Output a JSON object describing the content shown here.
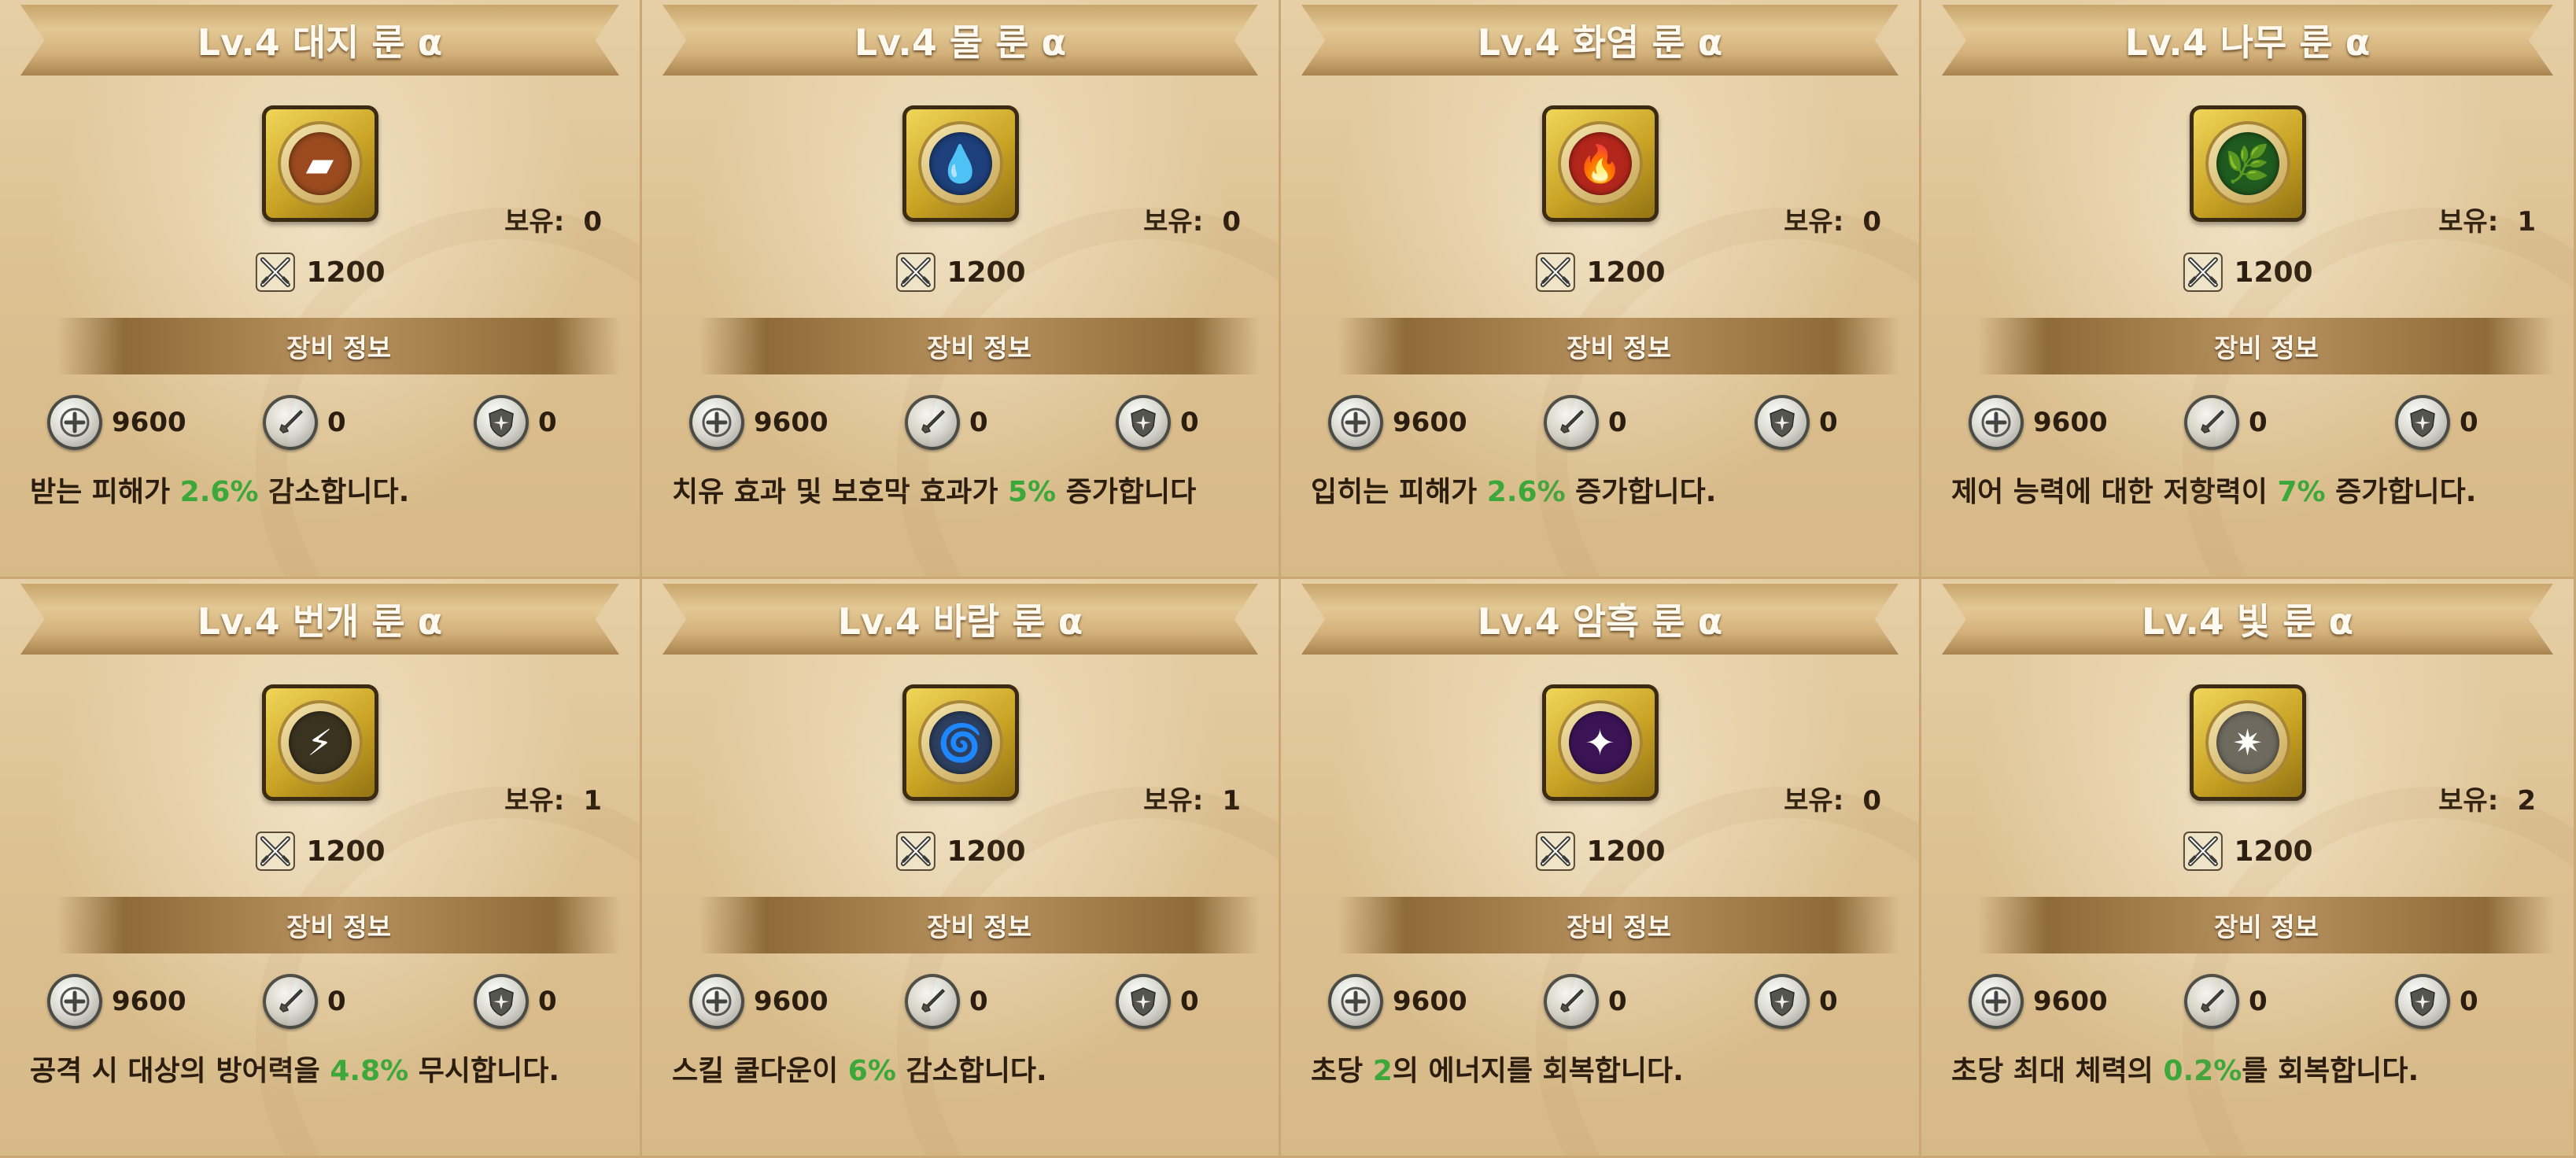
{
  "colors": {
    "highlight": "#3da83a",
    "card_bg": "#dcc196",
    "icon_frame": "#d8b530"
  },
  "cards": [
    {
      "title": "Lv.4 대지 룬 α",
      "rune_icon": "earth-rune-icon",
      "rune_color": "#9a4a1e",
      "rune_glyph": "▰",
      "owned_label": "보유:",
      "owned_value": "0",
      "cost": "1200",
      "section_label": "장비 정보",
      "hp": "9600",
      "atk": "0",
      "def": "0",
      "desc_pre": "받는 피해가 ",
      "desc_value": "2.6%",
      "desc_post": " 감소합니다."
    },
    {
      "title": "Lv.4 물 룬 α",
      "rune_icon": "water-rune-icon",
      "rune_color": "#1d3f7a",
      "rune_glyph": "💧",
      "owned_label": "보유:",
      "owned_value": "0",
      "cost": "1200",
      "section_label": "장비 정보",
      "hp": "9600",
      "atk": "0",
      "def": "0",
      "desc_pre": "치유 효과 및 보호막 효과가 ",
      "desc_value": "5%",
      "desc_post": " 증가합니다"
    },
    {
      "title": "Lv.4 화염 룬 α",
      "rune_icon": "fire-rune-icon",
      "rune_color": "#b3261b",
      "rune_glyph": "🔥",
      "owned_label": "보유:",
      "owned_value": "0",
      "cost": "1200",
      "section_label": "장비 정보",
      "hp": "9600",
      "atk": "0",
      "def": "0",
      "desc_pre": "입히는 피해가 ",
      "desc_value": "2.6%",
      "desc_post": " 증가합니다."
    },
    {
      "title": "Lv.4 나무 룬 α",
      "rune_icon": "wood-rune-icon",
      "rune_color": "#1f5a1f",
      "rune_glyph": "🌿",
      "owned_label": "보유:",
      "owned_value": "1",
      "cost": "1200",
      "section_label": "장비 정보",
      "hp": "9600",
      "atk": "0",
      "def": "0",
      "desc_pre": "제어 능력에 대한 저항력이 ",
      "desc_value": "7%",
      "desc_post": " 증가합니다."
    },
    {
      "title": "Lv.4 번개 룬 α",
      "rune_icon": "lightning-rune-icon",
      "rune_color": "#3a3320",
      "rune_glyph": "⚡",
      "owned_label": "보유:",
      "owned_value": "1",
      "cost": "1200",
      "section_label": "장비 정보",
      "hp": "9600",
      "atk": "0",
      "def": "0",
      "desc_pre": "공격 시 대상의 방어력을 ",
      "desc_value": "4.8%",
      "desc_post": " 무시합니다."
    },
    {
      "title": "Lv.4 바람 룬 α",
      "rune_icon": "wind-rune-icon",
      "rune_color": "#2c3f5f",
      "rune_glyph": "🌀",
      "owned_label": "보유:",
      "owned_value": "1",
      "cost": "1200",
      "section_label": "장비 정보",
      "hp": "9600",
      "atk": "0",
      "def": "0",
      "desc_pre": "스킬 쿨다운이 ",
      "desc_value": "6%",
      "desc_post": " 감소합니다."
    },
    {
      "title": "Lv.4 암흑 룬 α",
      "rune_icon": "dark-rune-icon",
      "rune_color": "#3b1456",
      "rune_glyph": "✦",
      "owned_label": "보유:",
      "owned_value": "0",
      "cost": "1200",
      "section_label": "장비 정보",
      "hp": "9600",
      "atk": "0",
      "def": "0",
      "desc_pre": "초당 ",
      "desc_value": "2",
      "desc_post": "의 에너지를 회복합니다."
    },
    {
      "title": "Lv.4 빛 룬 α",
      "rune_icon": "light-rune-icon",
      "rune_color": "#6e6a5e",
      "rune_glyph": "✷",
      "owned_label": "보유:",
      "owned_value": "2",
      "cost": "1200",
      "section_label": "장비 정보",
      "hp": "9600",
      "atk": "0",
      "def": "0",
      "desc_pre": "초당 최대 체력의 ",
      "desc_value": "0.2%",
      "desc_post": "를 회복합니다."
    }
  ]
}
